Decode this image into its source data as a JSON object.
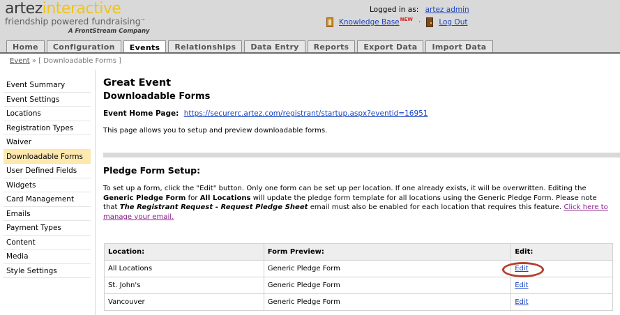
{
  "logo": {
    "brand_a": "artez",
    "brand_b": "interactive",
    "tagline": "friendship powered fundraising",
    "tm": "™",
    "subtitle": "A FrontStream Company"
  },
  "header": {
    "logged_in_label": "Logged in as:",
    "user": "artez admin",
    "knowledge_base": "Knowledge Base",
    "new_badge": "NEW",
    "separator": "·",
    "logout": "Log Out"
  },
  "tabs": [
    "Home",
    "Configuration",
    "Events",
    "Relationships",
    "Data Entry",
    "Reports",
    "Export Data",
    "Import Data"
  ],
  "active_tab": "Events",
  "breadcrumb": {
    "link": "Event",
    "arrow": "»",
    "current": "[ Downloadable Forms ]"
  },
  "sidebar": {
    "items": [
      {
        "label": "Event Summary"
      },
      {
        "label": "Event Settings"
      },
      {
        "label": "Locations"
      },
      {
        "label": "Registration Types"
      },
      {
        "label": "Waiver"
      },
      {
        "label": "Downloadable Forms"
      },
      {
        "label": "User Defined Fields"
      },
      {
        "label": "Widgets"
      },
      {
        "label": "Card Management"
      },
      {
        "label": "Emails"
      },
      {
        "label": "Payment Types"
      },
      {
        "label": "Content"
      },
      {
        "label": "Media"
      },
      {
        "label": "Style Settings"
      }
    ],
    "active": "Downloadable Forms"
  },
  "main": {
    "title": "Great Event",
    "subtitle": "Downloadable Forms",
    "home_page_label": "Event Home Page:",
    "home_page_url": "https://securerc.artez.com/registrant/startup.aspx?eventid=16951",
    "intro": "This page allows you to setup and preview downloadable forms.",
    "section_title": "Pledge Form Setup:",
    "para_1": "To set up a form, click the \"Edit\" button. Only one form can be set up per location. If one already exists, it will be overwritten. Editing the",
    "para_2a": "Generic Pledge Form",
    "para_2b": " for ",
    "para_2c": "All Locations",
    "para_2d": " will update the pledge form template for all locations using the Generic Pledge Form. Please note",
    "para_3a": "that ",
    "para_3b": "The Registrant Request - Request Pledge Sheet",
    "para_3c": " email must also be enabled for each location that requires this feature. ",
    "para_link_1": "Click here to",
    "para_link_2": "manage your email."
  },
  "table": {
    "headers": [
      "Location:",
      "Form Preview:",
      "Edit:"
    ],
    "rows": [
      {
        "location": "All Locations",
        "form": "Generic Pledge Form",
        "edit": "Edit"
      },
      {
        "location": "St. John's",
        "form": "Generic Pledge Form",
        "edit": "Edit"
      },
      {
        "location": "Vancouver",
        "form": "Generic Pledge Form",
        "edit": "Edit"
      }
    ]
  },
  "colors": {
    "active_sidebar": "#fde9b0",
    "highlight_circle": "#b5412e",
    "link": "#1a44c2"
  }
}
